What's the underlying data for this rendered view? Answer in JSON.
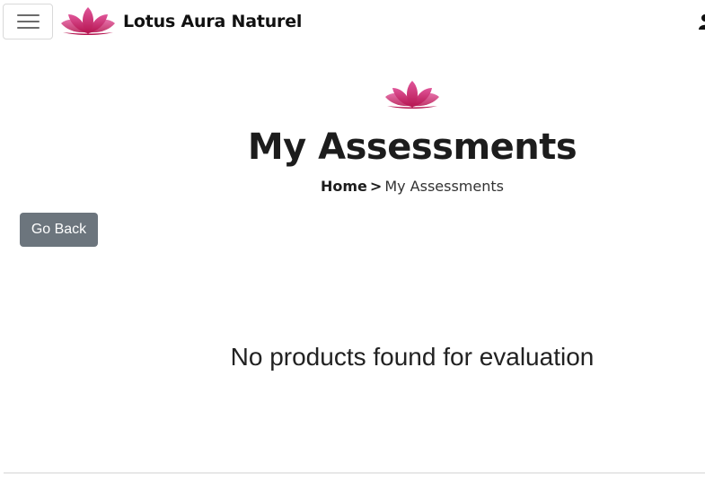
{
  "navbar": {
    "menu_icon": "hamburger-menu-icon",
    "brand_name": "Lotus Aura Naturel",
    "logo_icon": "lotus-logo-icon",
    "user_icon": "user-icon"
  },
  "header": {
    "logo_icon": "lotus-logo-icon",
    "title": "My Assessments",
    "breadcrumb": {
      "home": "Home",
      "separator": ">",
      "current": "My Assessments"
    }
  },
  "actions": {
    "go_back_label": "Go Back"
  },
  "main": {
    "empty_message": "No products found for evaluation"
  },
  "colors": {
    "lotus_dark": "#c2185b",
    "lotus_light": "#e25b9a",
    "secondary_button": "#6c757d"
  }
}
